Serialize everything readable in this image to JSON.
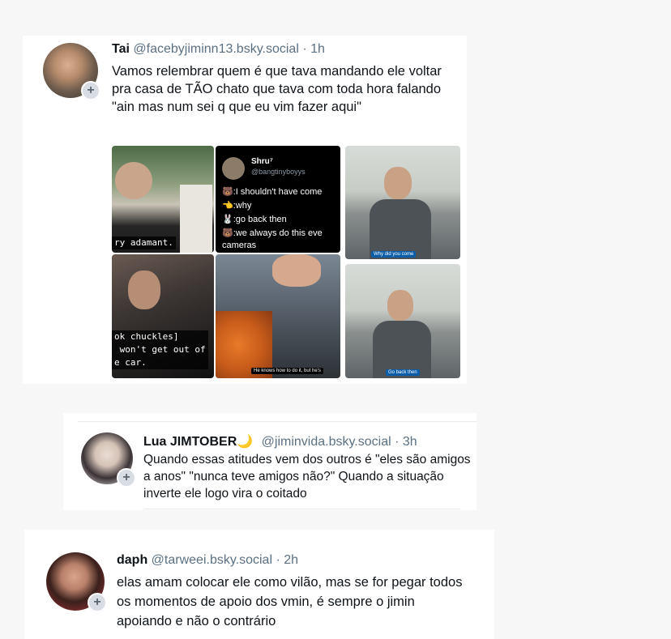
{
  "posts": [
    {
      "name": "Tai",
      "handle": "@facebyjiminn13.bsky.social",
      "sep": "·",
      "time": "1h",
      "text": "Vamos relembrar quem é que tava mandando ele voltar pra casa de TÃO chato que tava com toda hora falando \"ain mas num sei q que eu vim fazer aqui\"",
      "media": {
        "quote_name": "Shru⁷",
        "quote_handle": "@bangtinyboyys",
        "quote_lines": [
          "🐻:I shouldn't have come",
          "👈:why",
          "🐰:go back then",
          "🐻:we always do this eve",
          "cameras"
        ],
        "caption_adamant": "ry adamant.",
        "caption_car": "ok chuckles]\n won't get out of\ne car.",
        "caption_knows": "He knows how to do it, but he's",
        "caption_why": "Why did you come",
        "caption_goback": "Go back then"
      }
    },
    {
      "name": "Lua JIMTOBER",
      "emoji": "🌙",
      "handle": "@jiminvida.bsky.social",
      "sep": "·",
      "time": "3h",
      "text": "Quando essas atitudes vem dos outros é \"eles são amigos a anos\" \"nunca teve amigos não?\" Quando a situação inverte ele logo vira o coitado"
    },
    {
      "name": "daph",
      "handle": "@tarweei.bsky.social",
      "sep": "·",
      "time": "2h",
      "text": "elas amam colocar ele como vilão, mas se for pegar todos os momentos de apoio dos vmin, é sempre o jimin apoiando e não o contrário"
    }
  ],
  "follow_icon": "plus-icon",
  "colors": {
    "handle": "#5b7083",
    "text": "#0f1419",
    "plus_bg": "#d8dde3"
  }
}
